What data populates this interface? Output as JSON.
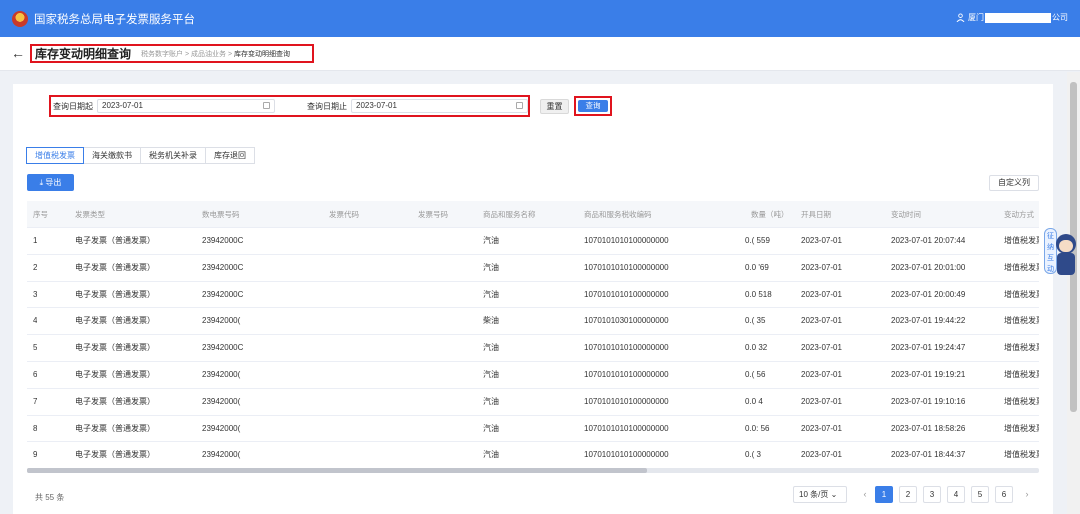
{
  "app": {
    "title": "国家税务总局电子发票服务平台",
    "user_prefix": "厦门",
    "user_suffix": "公司"
  },
  "header": {
    "back": "←",
    "page_title": "库存变动明细查询",
    "breadcrumb": [
      "税务数字账户",
      "成品油业务",
      "库存变动明细查询"
    ],
    "separator": ">"
  },
  "filters": {
    "start_label": "查询日期起",
    "start_value": "2023-07-01",
    "end_label": "查询日期止",
    "end_value": "2023-07-01",
    "reset_label": "重置",
    "query_label": "查询"
  },
  "tabs": [
    {
      "label": "增值税发票",
      "active": true
    },
    {
      "label": "海关缴款书",
      "active": false
    },
    {
      "label": "税务机关补录",
      "active": false
    },
    {
      "label": "库存退回",
      "active": false
    }
  ],
  "toolbar": {
    "export_label": "导出",
    "custom_columns_label": "自定义列"
  },
  "table": {
    "columns": [
      "序号",
      "发票类型",
      "数电票号码",
      "发票代码",
      "发票号码",
      "商品和服务名称",
      "商品和服务税收编码",
      "数量（吨）",
      "开具日期",
      "变动时间",
      "变动方式"
    ],
    "rows": [
      {
        "no": "1",
        "type": "电子发票（普通发票）",
        "invoice_no": "23942000C",
        "code": "",
        "number": "",
        "goods": "汽油",
        "tax_code": "1070101010100000000",
        "qty": "0.(  559",
        "issue_date": "2023-07-01",
        "change_time": "2023-07-01 20:07:44",
        "method": "增值税发票"
      },
      {
        "no": "2",
        "type": "电子发票（普通发票）",
        "invoice_no": "23942000C",
        "code": "",
        "number": "",
        "goods": "汽油",
        "tax_code": "1070101010100000000",
        "qty": "0.0  '69",
        "issue_date": "2023-07-01",
        "change_time": "2023-07-01 20:01:00",
        "method": "增值税发票"
      },
      {
        "no": "3",
        "type": "电子发票（普通发票）",
        "invoice_no": "23942000C",
        "code": "",
        "number": "",
        "goods": "汽油",
        "tax_code": "1070101010100000000",
        "qty": "0.0  518",
        "issue_date": "2023-07-01",
        "change_time": "2023-07-01 20:00:49",
        "method": "增值税发票"
      },
      {
        "no": "4",
        "type": "电子发票（普通发票）",
        "invoice_no": "23942000(",
        "code": "",
        "number": "",
        "goods": "柴油",
        "tax_code": "1070101030100000000",
        "qty": "0.(  35",
        "issue_date": "2023-07-01",
        "change_time": "2023-07-01 19:44:22",
        "method": "增值税发票"
      },
      {
        "no": "5",
        "type": "电子发票（普通发票）",
        "invoice_no": "23942000C",
        "code": "",
        "number": "",
        "goods": "汽油",
        "tax_code": "1070101010100000000",
        "qty": "0.0  32",
        "issue_date": "2023-07-01",
        "change_time": "2023-07-01 19:24:47",
        "method": "增值税发票"
      },
      {
        "no": "6",
        "type": "电子发票（普通发票）",
        "invoice_no": "23942000(",
        "code": "",
        "number": "",
        "goods": "汽油",
        "tax_code": "1070101010100000000",
        "qty": "0.(  56",
        "issue_date": "2023-07-01",
        "change_time": "2023-07-01 19:19:21",
        "method": "增值税发票"
      },
      {
        "no": "7",
        "type": "电子发票（普通发票）",
        "invoice_no": "23942000(",
        "code": "",
        "number": "",
        "goods": "汽油",
        "tax_code": "1070101010100000000",
        "qty": "0.0  4",
        "issue_date": "2023-07-01",
        "change_time": "2023-07-01 19:10:16",
        "method": "增值税发票"
      },
      {
        "no": "8",
        "type": "电子发票（普通发票）",
        "invoice_no": "23942000(",
        "code": "",
        "number": "",
        "goods": "汽油",
        "tax_code": "1070101010100000000",
        "qty": "0.0:  56",
        "issue_date": "2023-07-01",
        "change_time": "2023-07-01 18:58:26",
        "method": "增值税发票"
      },
      {
        "no": "9",
        "type": "电子发票（普通发票）",
        "invoice_no": "23942000(",
        "code": "",
        "number": "",
        "goods": "汽油",
        "tax_code": "1070101010100000000",
        "qty": "0.(  3",
        "issue_date": "2023-07-01",
        "change_time": "2023-07-01 18:44:37",
        "method": "增值税发票"
      }
    ]
  },
  "pagination": {
    "total": "共 55 条",
    "page_size": "10 条/页",
    "pages": [
      "1",
      "2",
      "3",
      "4",
      "5",
      "6"
    ],
    "current": 1,
    "prev": "‹",
    "next": "›"
  },
  "widget": {
    "tag": "征纳互动"
  },
  "colors": {
    "primary": "#3a7ee8",
    "highlight_border": "#e0141e"
  }
}
